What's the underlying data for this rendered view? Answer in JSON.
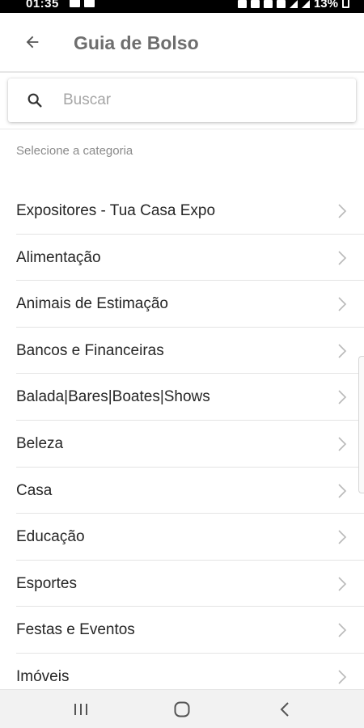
{
  "status_bar": {
    "time": "01:35",
    "battery": "13%"
  },
  "header": {
    "title": "Guia de Bolso",
    "back_icon": "arrow-left-icon"
  },
  "search": {
    "placeholder": "Buscar",
    "value": "",
    "icon": "search-icon"
  },
  "category_heading": "Selecione a categoria",
  "categories": [
    {
      "label": "Expositores - Tua Casa Expo"
    },
    {
      "label": "Alimentação"
    },
    {
      "label": "Animais de Estimação"
    },
    {
      "label": "Bancos e Financeiras"
    },
    {
      "label": "Balada|Bares|Boates|Shows"
    },
    {
      "label": "Beleza"
    },
    {
      "label": "Casa"
    },
    {
      "label": "Educação"
    },
    {
      "label": "Esportes"
    },
    {
      "label": "Festas e Eventos"
    },
    {
      "label": "Imóveis"
    }
  ],
  "nav_bar": {
    "recents_icon": "recent-apps-icon",
    "home_icon": "home-icon",
    "back_icon": "back-chevron-icon"
  },
  "colors": {
    "title": "#6e6e6e",
    "text": "#262626",
    "muted": "#8a8a8a",
    "divider": "#e4e4e4"
  }
}
